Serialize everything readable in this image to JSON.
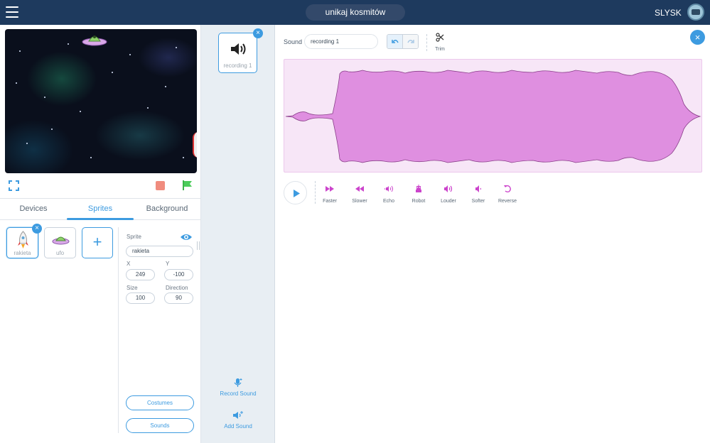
{
  "topbar": {
    "project_title": "unikaj kosmitów",
    "username": "SLYSK",
    "bg_color": "#1e3a5e"
  },
  "tabs": [
    {
      "label": "Devices",
      "active": false
    },
    {
      "label": "Sprites",
      "active": true
    },
    {
      "label": "Background",
      "active": false
    }
  ],
  "sprites": [
    {
      "label": "rakieta",
      "icon": "rocket-icon",
      "selected": true
    },
    {
      "label": "ufo",
      "icon": "ufo-icon",
      "selected": false
    }
  ],
  "add_sprite_label": "+",
  "properties": {
    "sprite_label": "Sprite",
    "sprite_name": "rakieta",
    "x_label": "X",
    "x_value": "249",
    "y_label": "Y",
    "y_value": "-100",
    "size_label": "Size",
    "size_value": "100",
    "direction_label": "Direction",
    "direction_value": "90"
  },
  "buttons": {
    "costumes": "Costumes",
    "sounds": "Sounds"
  },
  "sound_list": [
    {
      "label": "recording 1",
      "icon": "speaker-icon",
      "selected": true
    }
  ],
  "mid_actions": {
    "record_sound": "Record Sound",
    "add_sound": "Add Sound"
  },
  "editor": {
    "sound_label": "Sound",
    "sound_name": "recording 1",
    "trim_label": "Trim",
    "close_label": "×"
  },
  "effects": [
    {
      "label": "Faster",
      "icon": "faster-icon"
    },
    {
      "label": "Slower",
      "icon": "slower-icon"
    },
    {
      "label": "Echo",
      "icon": "echo-icon"
    },
    {
      "label": "Robot",
      "icon": "robot-icon"
    },
    {
      "label": "Louder",
      "icon": "louder-icon"
    },
    {
      "label": "Softer",
      "icon": "softer-icon"
    },
    {
      "label": "Reverse",
      "icon": "reverse-icon"
    }
  ],
  "colors": {
    "accent": "#3d9be0",
    "waveform_fill": "#df8fe0",
    "waveform_bg": "#f7e6f7",
    "effect_icon": "#cc44cc"
  }
}
